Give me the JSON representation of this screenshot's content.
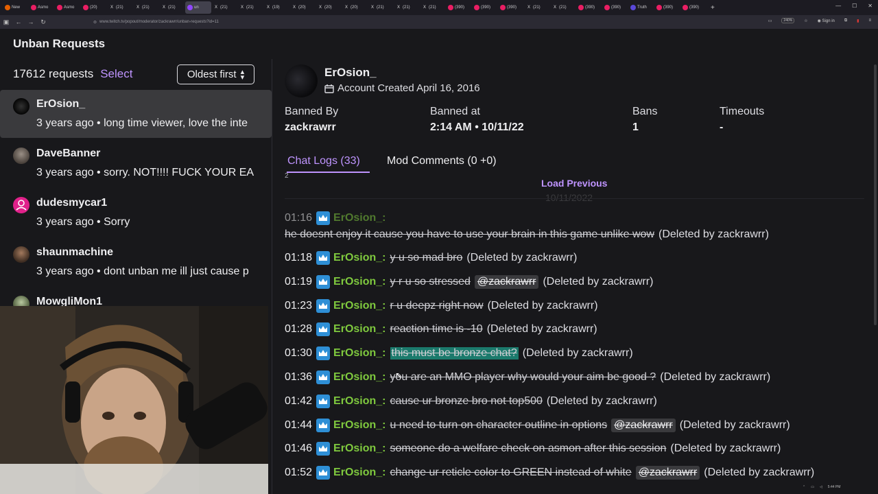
{
  "browser": {
    "tabs": [
      {
        "label": "New",
        "icon": "fox"
      },
      {
        "label": "Asmo",
        "icon": "red"
      },
      {
        "label": "Asmo",
        "icon": "red"
      },
      {
        "label": "(20)",
        "icon": "red"
      },
      {
        "label": "(21)",
        "icon": "x"
      },
      {
        "label": "(21)",
        "icon": "x"
      },
      {
        "label": "(21)",
        "icon": "x"
      },
      {
        "label": "un",
        "icon": "tw"
      },
      {
        "label": "(21)",
        "icon": "x"
      },
      {
        "label": "(21)",
        "icon": "x"
      },
      {
        "label": "(19)",
        "icon": "x"
      },
      {
        "label": "(20)",
        "icon": "x"
      },
      {
        "label": "(20)",
        "icon": "x"
      },
      {
        "label": "(20)",
        "icon": "x"
      },
      {
        "label": "(21)",
        "icon": "x"
      },
      {
        "label": "(21)",
        "icon": "x"
      },
      {
        "label": "(21)",
        "icon": "x"
      },
      {
        "label": "(390)",
        "icon": "red"
      },
      {
        "label": "(390)",
        "icon": "red"
      },
      {
        "label": "(390)",
        "icon": "red"
      },
      {
        "label": "(21)",
        "icon": "x"
      },
      {
        "label": "(21)",
        "icon": "x"
      },
      {
        "label": "(390)",
        "icon": "red"
      },
      {
        "label": "(390)",
        "icon": "red"
      },
      {
        "label": "Truth",
        "icon": "tr"
      },
      {
        "label": "(390)",
        "icon": "red"
      },
      {
        "label": "(390)",
        "icon": "red"
      }
    ],
    "url": "www.twitch.tv/popout/moderator/zackrawrr/unban-requests?id=11",
    "zoom": "240%",
    "sign_in": "Sign in"
  },
  "page_title": "Unban Requests",
  "list": {
    "count_label": "17612 requests",
    "select_label": "Select",
    "sort_label": "Oldest first",
    "items": [
      {
        "name": "ErOsion_",
        "meta": "3 years ago • long time viewer, love the inte",
        "avatar": "dark"
      },
      {
        "name": "DaveBanner",
        "meta": "3 years ago • sorry. NOT!!!! FUCK YOUR EA",
        "avatar": "photo"
      },
      {
        "name": "dudesmycar1",
        "meta": "3 years ago • Sorry",
        "avatar": "pink"
      },
      {
        "name": "shaunmachine",
        "meta": "3 years ago • dont unban me ill just cause p",
        "avatar": "photo2"
      },
      {
        "name": "MowgliMon1",
        "meta": "",
        "avatar": "photo3"
      }
    ]
  },
  "detail": {
    "username": "ErOsion_",
    "account_created": "Account Created April 16, 2016",
    "banned_by_label": "Banned By",
    "banned_by_value": "zackrawrr",
    "banned_at_label": "Banned at",
    "banned_at_value": "2:14 AM • 10/11/22",
    "bans_label": "Bans",
    "bans_value": "1",
    "timeouts_label": "Timeouts",
    "timeouts_value": "-",
    "tab_chat": "Chat Logs (33)",
    "tab_mod": "Mod Comments (0 +0)",
    "load_previous": "Load Previous",
    "ghost_date": "10/11/2022",
    "ghost_digit": "2"
  },
  "logs": [
    {
      "ts": "01:16",
      "nick": "ErOsion_:",
      "msg": "he doesnt enjoy it cause you have to use your brain in this game unlike wow",
      "deleted": "(Deleted by zackrawrr)",
      "wrap": true
    },
    {
      "ts": "01:18",
      "nick": "ErOsion_:",
      "msg": "y u so mad bro",
      "deleted": "(Deleted by zackrawrr)"
    },
    {
      "ts": "01:19",
      "nick": "ErOsion_:",
      "msg": "y r u so stressed",
      "mention": "@zackrawrr",
      "deleted": "(Deleted by zackrawrr)"
    },
    {
      "ts": "01:23",
      "nick": "ErOsion_:",
      "msg": "r u deepz right now",
      "deleted": "(Deleted by zackrawrr)"
    },
    {
      "ts": "01:28",
      "nick": "ErOsion_:",
      "msg": "reaction time is -10",
      "deleted": "(Deleted by zackrawrr)"
    },
    {
      "ts": "01:30",
      "nick": "ErOsion_:",
      "msg": "this must be bronze chat?",
      "deleted": "(Deleted by zackrawrr)",
      "highlight": true
    },
    {
      "ts": "01:36",
      "nick": "ErOsion_:",
      "msg": "you are an MMO player why would your aim be good ?",
      "deleted": "(Deleted by zackrawrr)"
    },
    {
      "ts": "01:42",
      "nick": "ErOsion_:",
      "msg": "cause ur bronze bro not top500",
      "deleted": "(Deleted by zackrawrr)"
    },
    {
      "ts": "01:44",
      "nick": "ErOsion_:",
      "msg": "u need to turn on character outline in options",
      "mention": "@zackrawrr",
      "deleted": "(Deleted by zackrawrr)"
    },
    {
      "ts": "01:46",
      "nick": "ErOsion_:",
      "msg": "someone do a welfare check on asmon after this session",
      "deleted": "(Deleted by zackrawrr)"
    },
    {
      "ts": "01:52",
      "nick": "ErOsion_:",
      "msg": "change ur reticle color to GREEN instead of white",
      "mention": "@zackrawrr",
      "deleted": "(Deleted by zackrawrr)"
    }
  ],
  "colors": {
    "accent": "#bf94ff",
    "nick": "#7fc93e",
    "badge": "#2e8fd6",
    "bg": "#18181b"
  }
}
